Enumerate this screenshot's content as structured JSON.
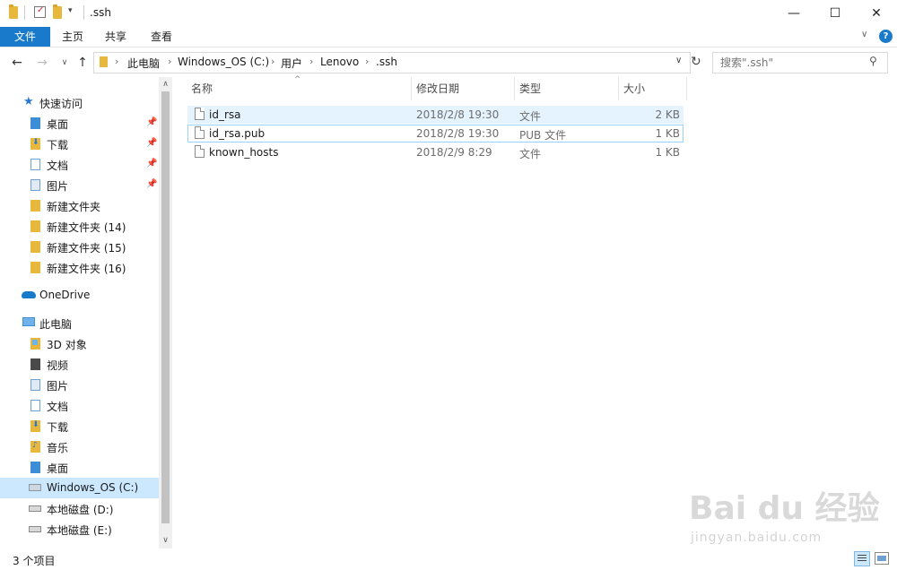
{
  "window": {
    "title": ".ssh",
    "minimize": "—",
    "maximize": "☐",
    "close": "✕"
  },
  "ribbon": {
    "tabs": [
      "文件",
      "主页",
      "共享",
      "查看"
    ],
    "help": "?"
  },
  "address": {
    "crumbs": [
      "此电脑",
      "Windows_OS (C:)",
      "用户",
      "Lenovo",
      ".ssh"
    ]
  },
  "search": {
    "placeholder": "搜索\".ssh\""
  },
  "sidebar": {
    "quick_access": "快速访问",
    "quick_items": [
      "桌面",
      "下载",
      "文档",
      "图片",
      "新建文件夹",
      "新建文件夹 (14)",
      "新建文件夹 (15)",
      "新建文件夹 (16)"
    ],
    "onedrive": "OneDrive",
    "this_pc": "此电脑",
    "pc_items": [
      "3D 对象",
      "视频",
      "图片",
      "文档",
      "下载",
      "音乐",
      "桌面",
      "Windows_OS (C:)",
      "本地磁盘 (D:)",
      "本地磁盘 (E:)"
    ]
  },
  "columns": {
    "name": "名称",
    "modified": "修改日期",
    "type": "类型",
    "size": "大小"
  },
  "files": [
    {
      "name": "id_rsa",
      "modified": "2018/2/8 19:30",
      "type": "文件",
      "size": "2 KB"
    },
    {
      "name": "id_rsa.pub",
      "modified": "2018/2/8 19:30",
      "type": "PUB 文件",
      "size": "1 KB"
    },
    {
      "name": "known_hosts",
      "modified": "2018/2/9 8:29",
      "type": "文件",
      "size": "1 KB"
    }
  ],
  "status": {
    "count": "3 个项目"
  },
  "watermark": {
    "brand": "Bai du 经验",
    "url": "jingyan.baidu.com"
  },
  "colors": {
    "accent": "#1979ca",
    "selection": "#cce8ff",
    "hover": "#e5f3ff",
    "folder": "#e8b83c"
  }
}
